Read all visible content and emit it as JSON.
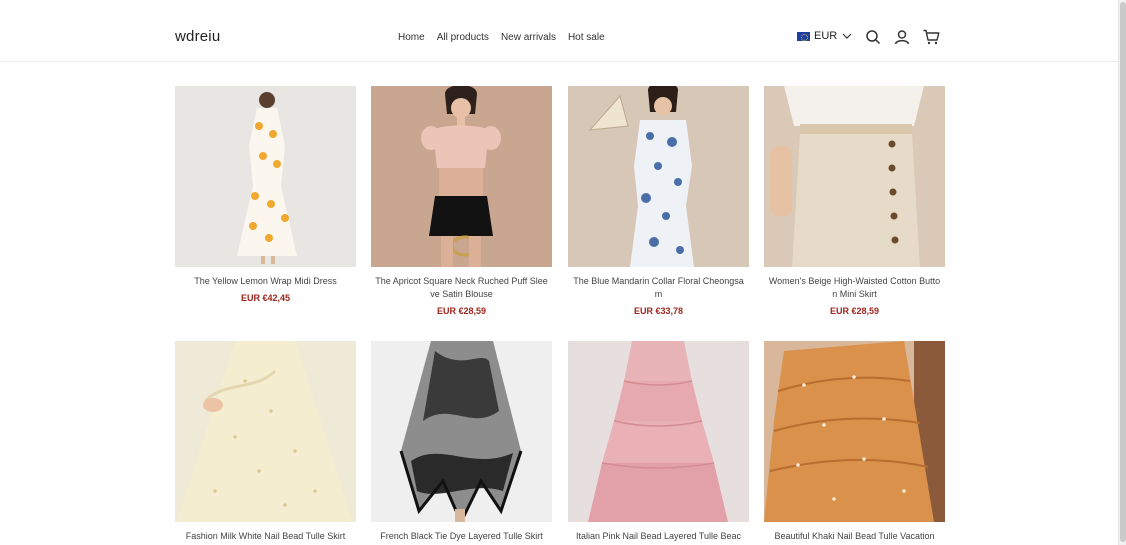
{
  "header": {
    "brand": "wdreiu",
    "nav": [
      "Home",
      "All products",
      "New arrivals",
      "Hot sale"
    ],
    "currency": "EUR",
    "icons": [
      "search-icon",
      "account-icon",
      "cart-icon"
    ]
  },
  "products": [
    {
      "title": "The Yellow Lemon Wrap Midi Dress",
      "price": "EUR €42,45"
    },
    {
      "title": "The Apricot Square Neck Ruched Puff Sleeve Satin Blouse",
      "price": "EUR €28,59"
    },
    {
      "title": "The Blue Mandarin Collar Floral Cheongsam",
      "price": "EUR €33,78"
    },
    {
      "title": "Women's Beige High-Waisted Cotton Button Mini Skirt",
      "price": "EUR €28,59"
    },
    {
      "title": "Fashion Milk White Nail Bead Tulle Skirt",
      "price": ""
    },
    {
      "title": "French Black Tie Dye Layered Tulle Skirt",
      "price": ""
    },
    {
      "title": "Italian Pink Nail Bead Layered Tulle Beac",
      "price": ""
    },
    {
      "title": "Beautiful Khaki Nail Bead Tulle Vacation",
      "price": ""
    }
  ],
  "colors": {
    "price": "#a0261d",
    "accent": "#1e3f9e"
  }
}
